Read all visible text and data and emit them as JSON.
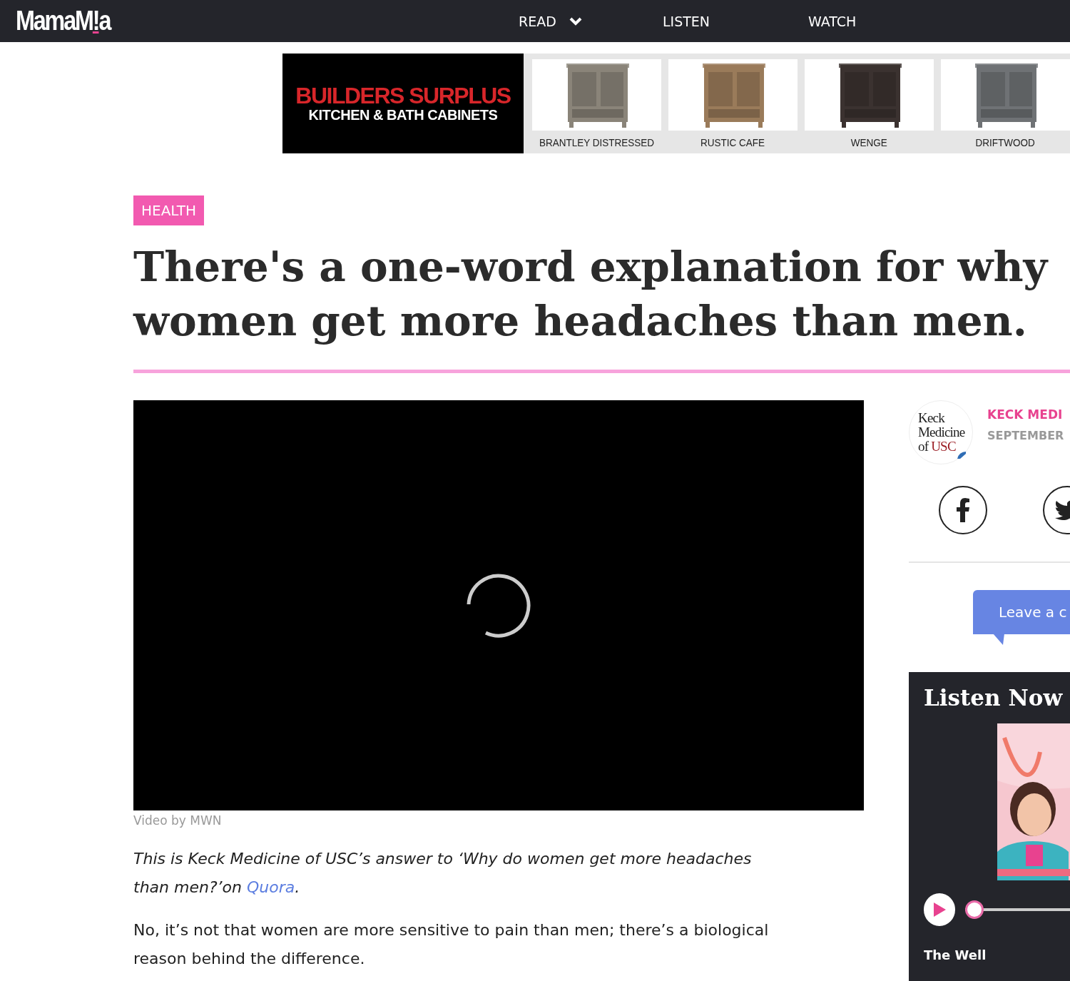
{
  "nav": {
    "logo": {
      "before": "MamaM",
      "mark": "!",
      "after": "a"
    },
    "items": [
      {
        "label": "READ",
        "dropdown": true
      },
      {
        "label": "LISTEN",
        "dropdown": false
      },
      {
        "label": "WATCH",
        "dropdown": false
      }
    ]
  },
  "ad": {
    "brand": "BUILDERS SURPLUS",
    "tagline": "KITCHEN & BATH CABINETS",
    "products": [
      {
        "label": "BRANTLEY DISTRESSED",
        "color": "#8a8479"
      },
      {
        "label": "RUSTIC CAFE",
        "color": "#9a7b5a"
      },
      {
        "label": "WENGE",
        "color": "#3b3230"
      },
      {
        "label": "DRIFTWOOD",
        "color": "#6f7275"
      }
    ]
  },
  "article": {
    "category": "HEALTH",
    "headline": "There's a one-word explanation for why women get more headaches than men.",
    "video": {
      "loading": true,
      "caption": "Video by MWN"
    },
    "intro": {
      "text": "This is Keck Medicine of USC’s answer to ‘Why do women get more headaches than men?’on ",
      "link": "Quora",
      "after": "."
    },
    "paragraphs": [
      "No, it’s not that women are more sensitive to pain than men; there’s a biological reason behind the difference."
    ]
  },
  "sidebar": {
    "author": {
      "logo": {
        "line1": "Keck",
        "line2": "Medicine",
        "line3a": "of",
        "line3b": "USC"
      },
      "name": "KECK MEDI",
      "date": "SEPTEMBER"
    },
    "share": [
      {
        "kind": "facebook"
      },
      {
        "kind": "twitter"
      }
    ],
    "comment_button": "Leave a c",
    "listen": {
      "title": "Listen Now",
      "player": {
        "playing": false,
        "level": 0.0
      },
      "show": "The Well"
    }
  }
}
